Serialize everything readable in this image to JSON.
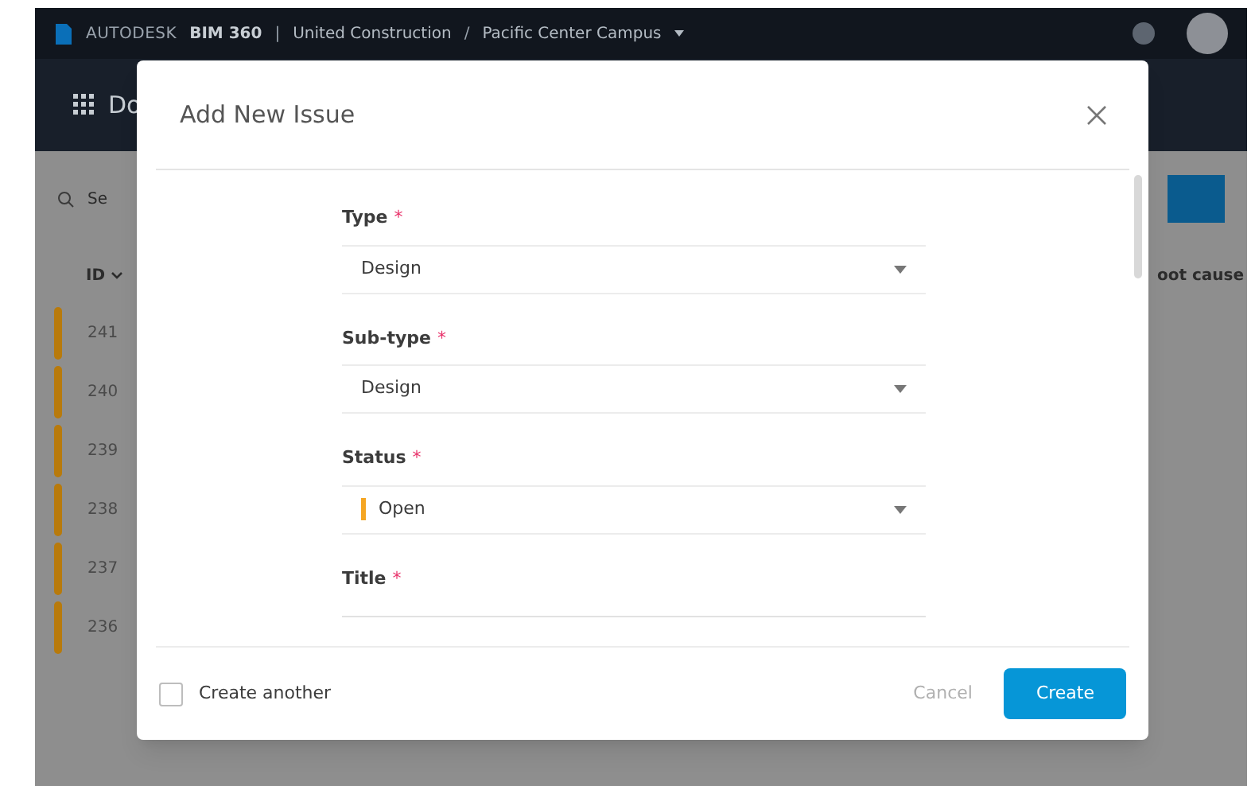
{
  "header": {
    "brand": "AUTODESK",
    "product": "BIM 360",
    "separator": "|",
    "account": "United Construction",
    "slash": "/",
    "project": "Pacific Center Campus"
  },
  "subbar": {
    "title": "Do"
  },
  "search": {
    "placeholder": "Se"
  },
  "table": {
    "columns": [
      {
        "label": "ID"
      },
      {
        "label": "oot cause"
      }
    ],
    "rows": [
      {
        "id": "241",
        "color": "#b87a0c"
      },
      {
        "id": "240",
        "color": "#b87a0c"
      },
      {
        "id": "239",
        "color": "#b87a0c"
      },
      {
        "id": "238",
        "color": "#b87a0c"
      },
      {
        "id": "237",
        "color": "#b87a0c"
      },
      {
        "id": "236",
        "color": "#b87a0c"
      }
    ]
  },
  "dialog": {
    "title": "Add New Issue",
    "fields": [
      {
        "kind": "select",
        "label": "Type",
        "required_mark": "*",
        "value": "Design"
      },
      {
        "kind": "select",
        "label": "Sub-type",
        "required_mark": "*",
        "value": "Design"
      },
      {
        "kind": "status",
        "label": "Status",
        "required_mark": "*",
        "value": "Open",
        "color": "#f5a623"
      },
      {
        "kind": "text",
        "label": "Title",
        "required_mark": "*"
      }
    ],
    "create_another": {
      "label": "Create another",
      "checked": false
    },
    "buttons": [
      {
        "label": "Cancel",
        "kind": "secondary"
      },
      {
        "label": "Create",
        "kind": "primary"
      }
    ]
  }
}
